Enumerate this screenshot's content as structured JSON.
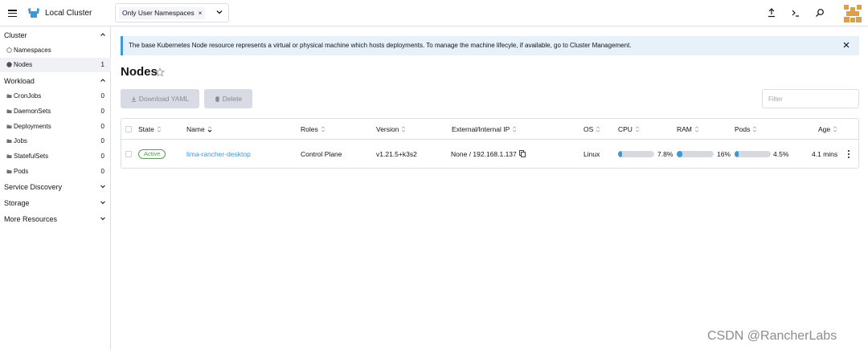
{
  "header": {
    "cluster_name": "Local Cluster",
    "namespace_filter": {
      "chip_label": "Only User Namespaces",
      "remove_glyph": "×"
    },
    "icons": [
      "menu-icon",
      "cluster-logo-icon",
      "upload-icon",
      "shell-icon",
      "search-icon",
      "avatar"
    ]
  },
  "sidebar": {
    "cluster": {
      "label": "Cluster",
      "items": [
        {
          "label": "Namespaces",
          "count": ""
        },
        {
          "label": "Nodes",
          "count": "1"
        }
      ]
    },
    "workload": {
      "label": "Workload",
      "items": [
        {
          "label": "CronJobs",
          "count": "0"
        },
        {
          "label": "DaemonSets",
          "count": "0"
        },
        {
          "label": "Deployments",
          "count": "0"
        },
        {
          "label": "Jobs",
          "count": "0"
        },
        {
          "label": "StatefulSets",
          "count": "0"
        },
        {
          "label": "Pods",
          "count": "0"
        }
      ]
    },
    "service_discovery": {
      "label": "Service Discovery"
    },
    "storage": {
      "label": "Storage"
    },
    "more_resources": {
      "label": "More Resources"
    }
  },
  "banner": {
    "text": "The base Kubernetes Node resource represents a virtual or physical machine which hosts deployments. To manage the machine lifecyle, if available, go to Cluster Management."
  },
  "page": {
    "title": "Nodes",
    "download_yaml_label": "Download YAML",
    "delete_label": "Delete",
    "filter_placeholder": "Filter"
  },
  "table": {
    "columns": [
      "State",
      "Name",
      "Roles",
      "Version",
      "External/Internal IP",
      "OS",
      "CPU",
      "RAM",
      "Pods",
      "Age"
    ],
    "rows": [
      {
        "state": "Active",
        "name": "lima-rancher-desktop",
        "roles": "Control Plane",
        "version": "v1.21.5+k3s2",
        "ip": "None / 192.168.1.137",
        "os": "Linux",
        "cpu": "7.8%",
        "cpu_fraction": 0.078,
        "ram": "16%",
        "ram_fraction": 0.16,
        "pods": "4.5%",
        "pods_fraction": 0.045,
        "age": "4.1 mins"
      }
    ]
  },
  "colors": {
    "accent": "#3d98d3",
    "active": "#5d995d",
    "border": "#dcdee7",
    "avatar": "#d9a14a"
  },
  "watermark": "CSDN @RancherLabs"
}
